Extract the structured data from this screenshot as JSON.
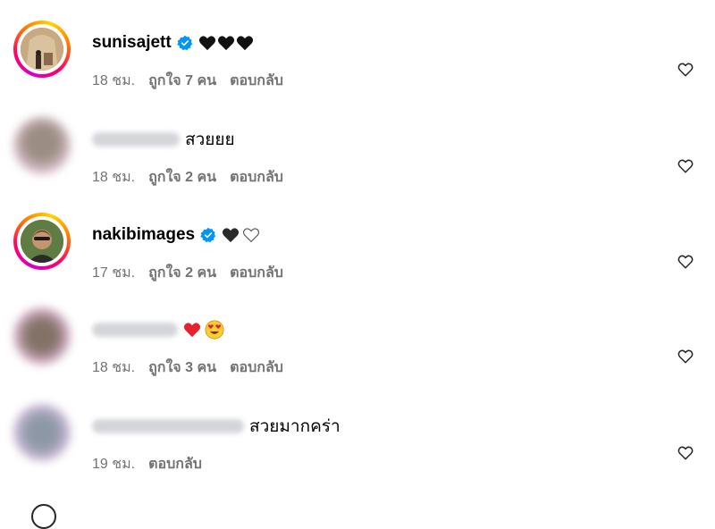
{
  "comments": [
    {
      "username": "sunisajett",
      "verified": true,
      "text": "",
      "emoji": [
        "black-heart",
        "black-heart",
        "black-heart"
      ],
      "time": "18 ชม.",
      "likes": "ถูกใจ 7 คน",
      "reply": "ตอบกลับ"
    },
    {
      "username": "",
      "verified": false,
      "text": "สวยยย",
      "time": "18 ชม.",
      "likes": "ถูกใจ 2 คน",
      "reply": "ตอบกลับ"
    },
    {
      "username": "nakibimages",
      "verified": true,
      "text": "",
      "emoji": [
        "black-heart",
        "white-heart"
      ],
      "time": "17 ชม.",
      "likes": "ถูกใจ 2 คน",
      "reply": "ตอบกลับ"
    },
    {
      "username": "",
      "verified": false,
      "text": "",
      "emoji": [
        "red-heart",
        "heart-eyes-face"
      ],
      "time": "18 ชม.",
      "likes": "ถูกใจ 3 คน",
      "reply": "ตอบกลับ"
    },
    {
      "username": "",
      "verified": false,
      "text": "สวยมากคร่า",
      "time": "19 ชม.",
      "reply": "ตอบกลับ"
    }
  ],
  "colors": {
    "verified": "#0095f6",
    "meta_text": "#737373",
    "story_ring": [
      "#d300c5",
      "#ff0069",
      "#ff7a00",
      "#ffd600"
    ]
  },
  "icons": {
    "like": "heart-outline-icon",
    "verified": "verified-badge-icon"
  }
}
